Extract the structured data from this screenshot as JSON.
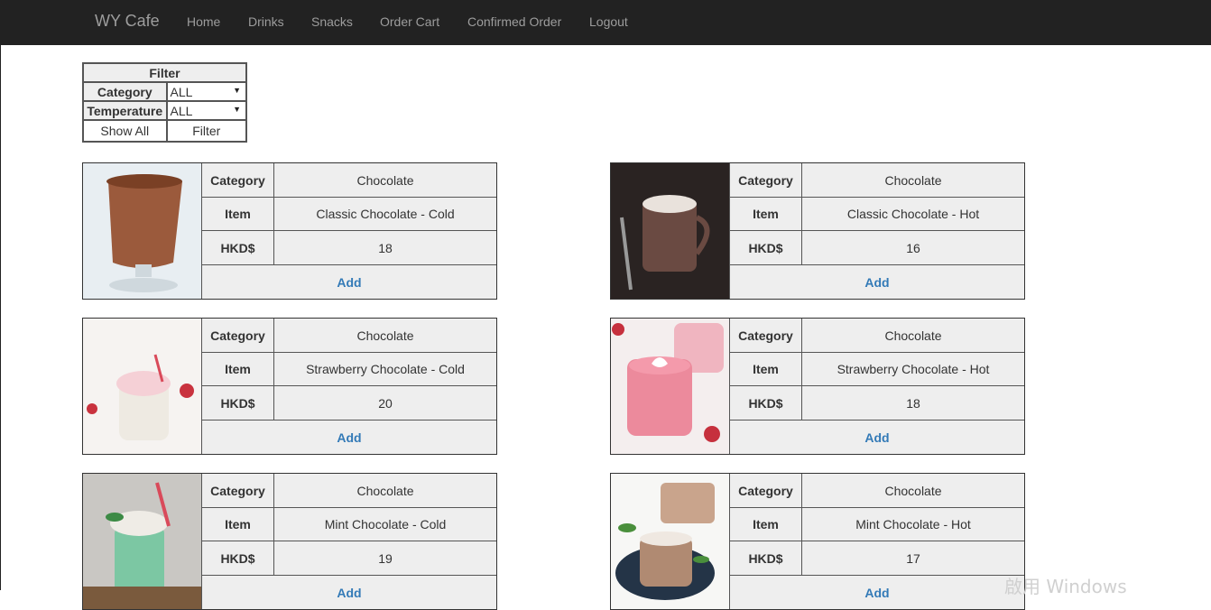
{
  "nav": {
    "brand": "WY Cafe",
    "links": [
      "Home",
      "Drinks",
      "Snacks",
      "Order Cart",
      "Confirmed Order",
      "Logout"
    ]
  },
  "filter": {
    "title": "Filter",
    "category_label": "Category",
    "category_value": "ALL",
    "temperature_label": "Temperature",
    "temperature_value": "ALL",
    "show_all": "Show All",
    "filter_button": "Filter"
  },
  "labels": {
    "category": "Category",
    "item": "Item",
    "price": "HKD$",
    "add": "Add"
  },
  "products": [
    {
      "category": "Chocolate",
      "item": "Classic Chocolate - Cold",
      "price": "18",
      "image": "cold-chocolate-drink-image"
    },
    {
      "category": "Chocolate",
      "item": "Classic Chocolate - Hot",
      "price": "16",
      "image": "hot-chocolate-mug-image"
    },
    {
      "category": "Chocolate",
      "item": "Strawberry Chocolate - Cold",
      "price": "20",
      "image": "strawberry-cold-drink-image"
    },
    {
      "category": "Chocolate",
      "item": "Strawberry Chocolate - Hot",
      "price": "18",
      "image": "strawberry-hot-drink-image"
    },
    {
      "category": "Chocolate",
      "item": "Mint Chocolate - Cold",
      "price": "19",
      "image": "mint-cold-drink-image"
    },
    {
      "category": "Chocolate",
      "item": "Mint Chocolate - Hot",
      "price": "17",
      "image": "mint-hot-drink-image"
    }
  ],
  "watermark": "啟用 Windows"
}
